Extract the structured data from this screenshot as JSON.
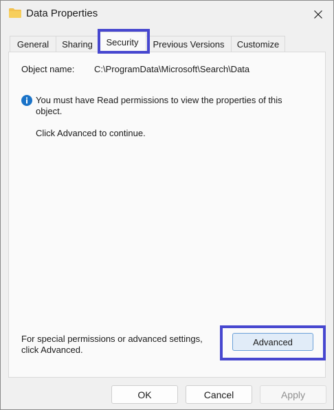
{
  "window": {
    "title": "Data Properties"
  },
  "tabs": [
    {
      "label": "General",
      "active": false
    },
    {
      "label": "Sharing",
      "active": false
    },
    {
      "label": "Security",
      "active": true
    },
    {
      "label": "Previous Versions",
      "active": false
    },
    {
      "label": "Customize",
      "active": false
    }
  ],
  "security": {
    "object_name_label": "Object name:",
    "object_name_value": "C:\\ProgramData\\Microsoft\\Search\\Data",
    "info_message": "You must have Read permissions to view the properties of this object.",
    "continue_message": "Click Advanced to continue.",
    "special_permissions_text": "For special permissions or advanced settings, click Advanced.",
    "advanced_button": "Advanced"
  },
  "buttons": {
    "ok": "OK",
    "cancel": "Cancel",
    "apply": "Apply",
    "apply_enabled": false
  },
  "icons": {
    "window": "folder-icon",
    "close": "close-icon",
    "info": "info-icon"
  },
  "colors": {
    "highlight": "#4747cf",
    "info_icon": "#1a73c8",
    "folder": "#f2c14e",
    "advanced_button_bg": "#e1ecf8"
  }
}
